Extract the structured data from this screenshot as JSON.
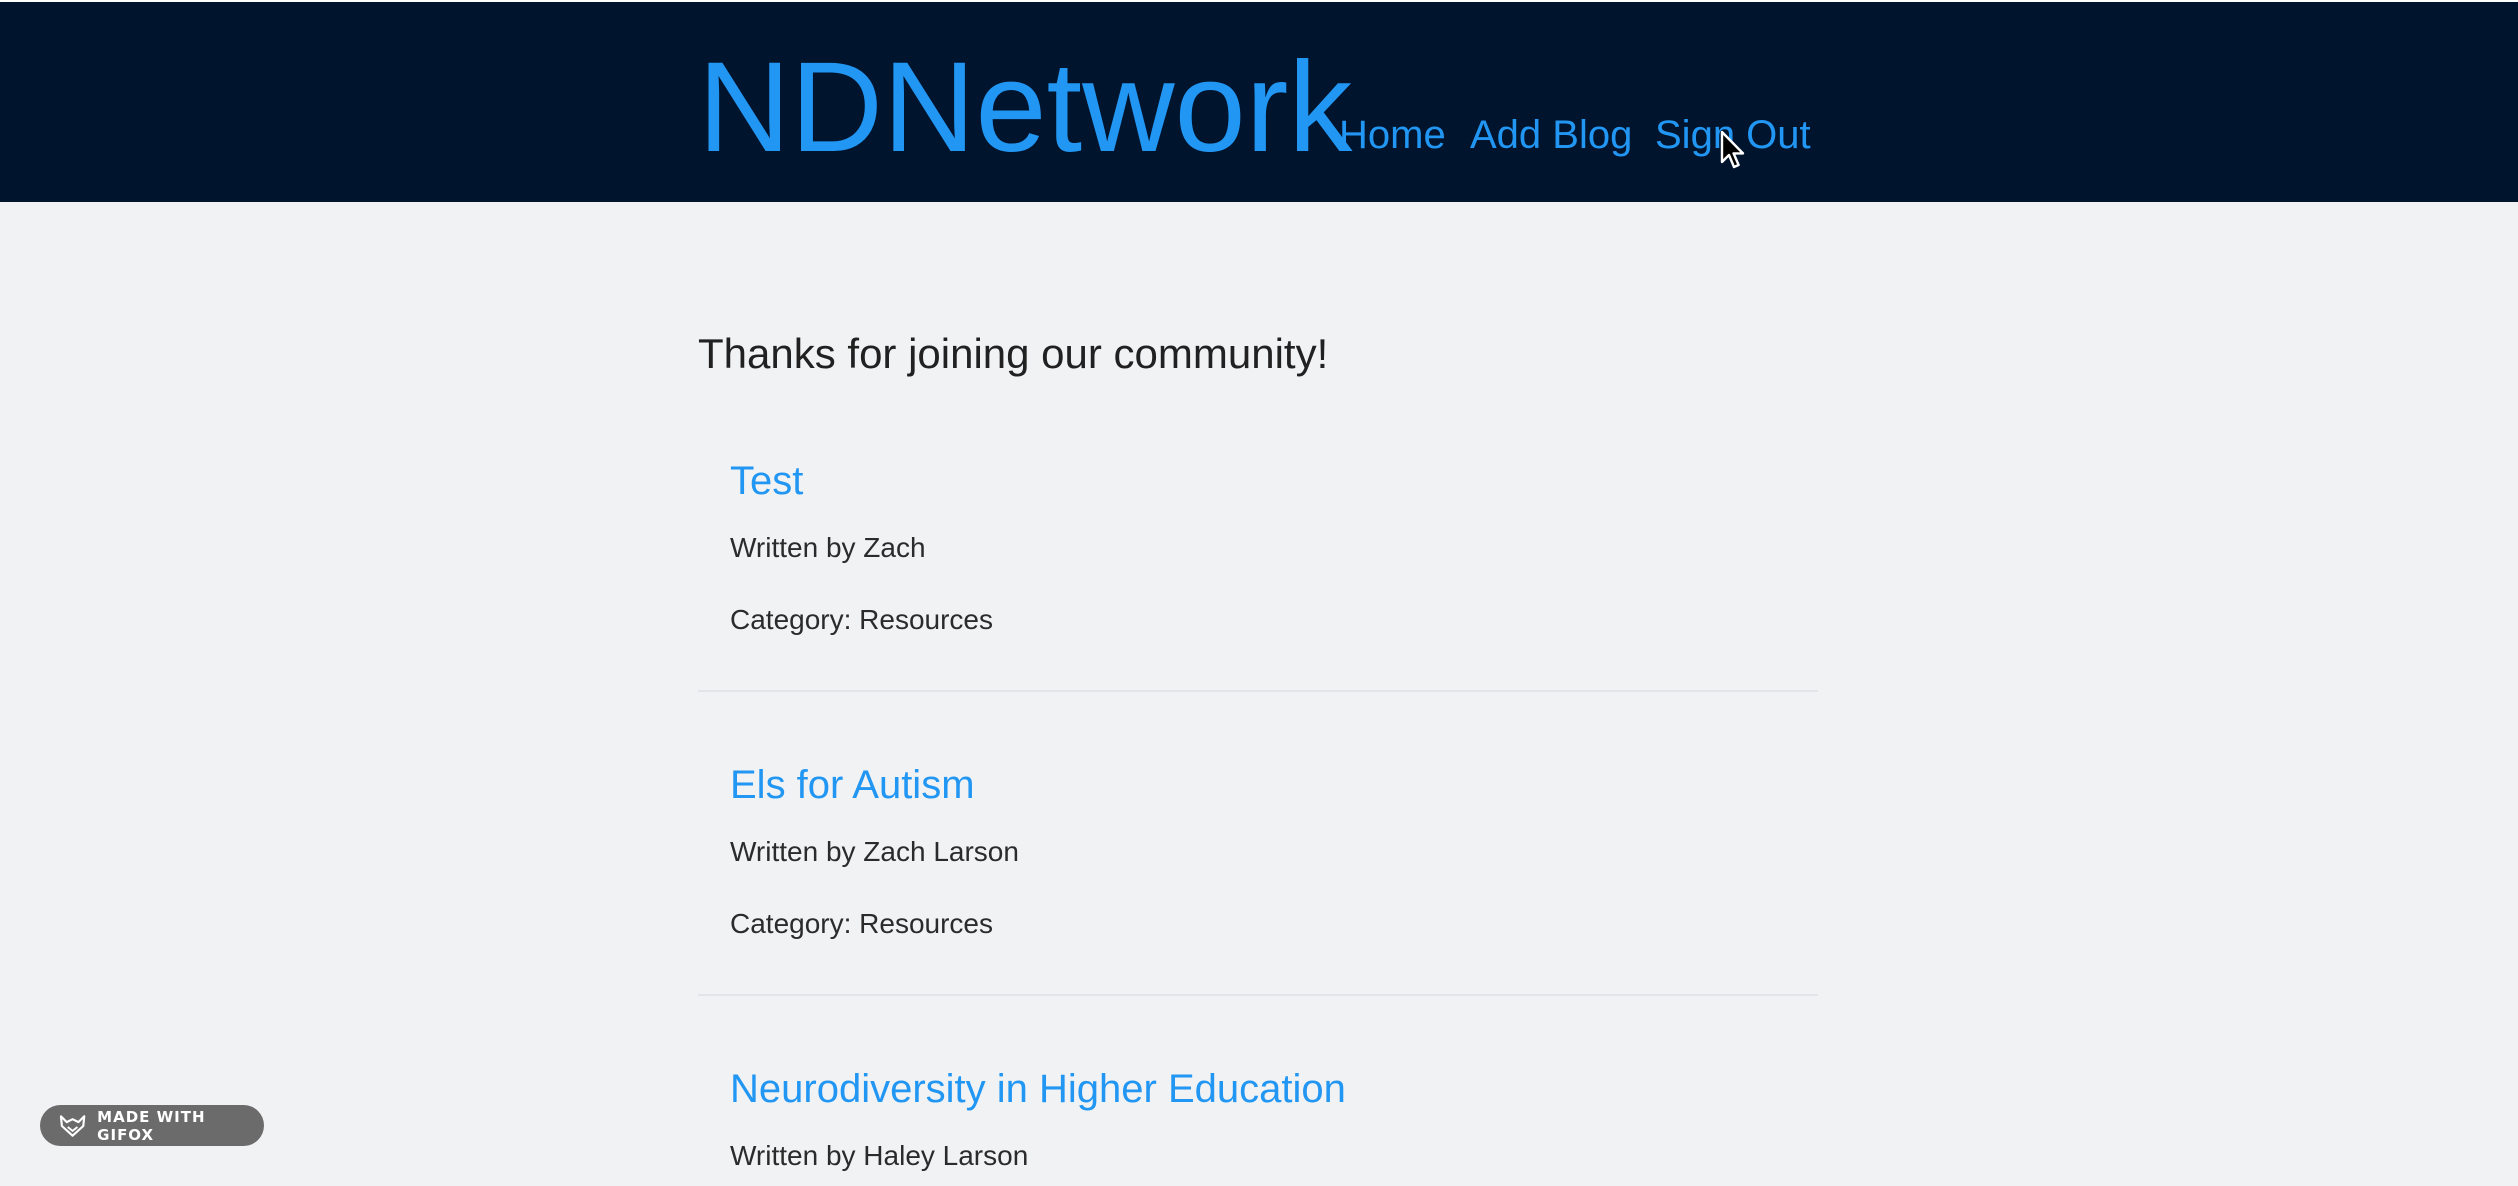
{
  "header": {
    "brand": "NDNetwork",
    "nav": {
      "home": "Home",
      "add_blog": "Add Blog",
      "sign_out": "Sign Out"
    },
    "background": "#00142e",
    "link_color": "#2196f3"
  },
  "main": {
    "welcome": "Thanks for joining our community!",
    "posts": [
      {
        "title": "Test",
        "author": "Written by Zach",
        "category": "Category: Resources"
      },
      {
        "title": "Els for Autism",
        "author": "Written by Zach Larson",
        "category": "Category: Resources"
      },
      {
        "title": "Neurodiversity in Higher Education",
        "author": "Written by Haley Larson",
        "category": ""
      }
    ]
  },
  "badge": {
    "label": "MADE WITH GIFOX",
    "icon": "fox-icon"
  },
  "colors": {
    "page_background": "#f1f2f4",
    "text": "#212121"
  }
}
